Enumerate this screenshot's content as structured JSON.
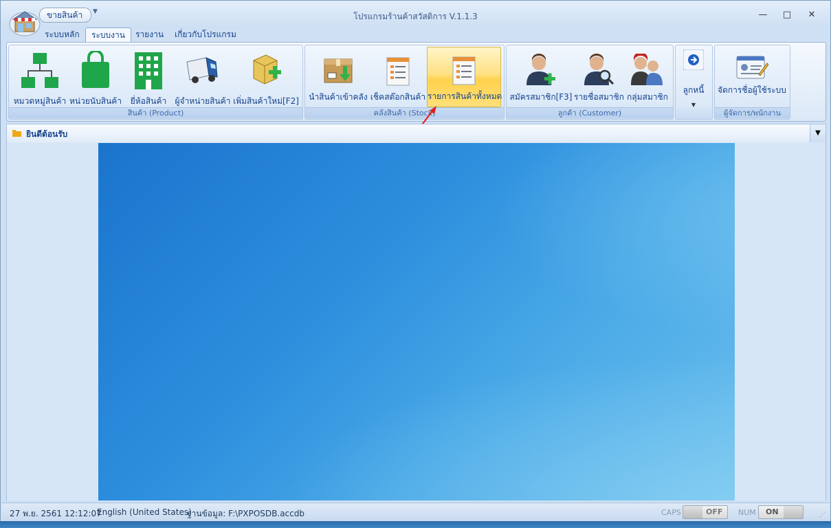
{
  "window": {
    "title": "โปรแกรมร้านค้าสวัสดิการ V.1.1.3",
    "quick_access_label": "ขายสินค้า",
    "minimize": "—",
    "maximize": "□",
    "close": "✕"
  },
  "tabs": [
    {
      "label": "ระบบหลัก"
    },
    {
      "label": "ระบบงาน"
    },
    {
      "label": "รายงาน"
    },
    {
      "label": "เกี่ยวกับโปรแกรม"
    }
  ],
  "ribbon": {
    "groups": [
      {
        "label": "สินค้า (Product)",
        "buttons": [
          {
            "label": "หมวดหมู่สินค้า",
            "icon": "hierarchy-icon"
          },
          {
            "label": "หน่วยนับสินค้า",
            "icon": "shopping-bag-icon"
          },
          {
            "label": "ยี่ห้อสินค้า",
            "icon": "building-icon"
          },
          {
            "label": "ผู้จำหน่ายสินค้า",
            "icon": "truck-icon"
          },
          {
            "label": "เพิ่มสินค้าใหม่[F2]",
            "icon": "box-add-icon"
          }
        ]
      },
      {
        "label": "คลังสินค้า (Stock)",
        "buttons": [
          {
            "label": "นำสินค้าเข้าคลัง",
            "icon": "box-import-icon"
          },
          {
            "label": "เช็คสต๊อกสินค้า",
            "icon": "document-list-icon"
          },
          {
            "label": "รายการสินค้าทั้งหมด",
            "icon": "document-list-icon"
          }
        ]
      },
      {
        "label": "ลูกค้า (Customer)",
        "buttons": [
          {
            "label": "สมัครสมาชิก[F3]",
            "icon": "user-add-icon"
          },
          {
            "label": "รายชื่อสมาชิก",
            "icon": "user-search-icon"
          },
          {
            "label": "กลุ่มสมาชิก",
            "icon": "user-group-icon"
          }
        ]
      },
      {
        "label": "",
        "buttons": [
          {
            "label": "ลูกหนี้",
            "icon": "arrow-circle-icon"
          }
        ]
      },
      {
        "label": "ผู้จัดการ/พนักงาน",
        "buttons": [
          {
            "label": "จัดการชื่อผู้ใช้ระบบ",
            "icon": "id-card-icon"
          }
        ]
      }
    ]
  },
  "document": {
    "title": "ยินดีต้อนรับ"
  },
  "status": {
    "datetime": "27 พ.ย. 2561 12:12:07",
    "language": "English (United States)",
    "database": "ฐานข้อมูล: F:\\PXPOSDB.accdb",
    "caps_label": "CAPS",
    "caps_value": "OFF",
    "num_label": "NUM",
    "num_value": "ON"
  },
  "colors": {
    "accent_green": "#1fa64a",
    "highlight": "#ffd24d",
    "arrow": "#e01e1e"
  }
}
